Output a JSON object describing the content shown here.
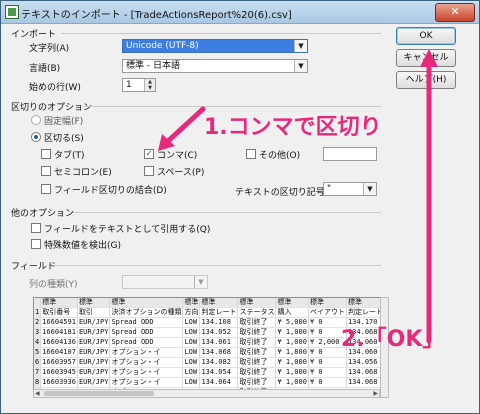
{
  "window": {
    "title": "テキストのインポート - [TradeActionsReport%20(6).csv]",
    "close": "✕"
  },
  "import": {
    "section": "インポート",
    "charset_label": "文字列(A)",
    "charset_value": "Unicode (UTF-8)",
    "language_label": "言語(B)",
    "language_value": "標準 - 日本語",
    "start_row_label": "始めの行(W)",
    "start_row_value": "1"
  },
  "separator": {
    "section": "区切りのオプション",
    "fixed_width": "固定幅(F)",
    "separated": "区切る(S)",
    "tab": "タブ(T)",
    "comma": "コンマ(C)",
    "other": "その他(O)",
    "semicolon": "セミコロン(E)",
    "space": "スペース(P)",
    "merge": "フィールド区切りの結合(D)",
    "text_delimiter_label": "テキストの区切り記号(X)",
    "text_delimiter_value": "\""
  },
  "other_options": {
    "section": "他のオプション",
    "quoted_as_text": "フィールドをテキストとして引用する(Q)",
    "detect_special": "特殊数値を検出(G)"
  },
  "fields": {
    "section": "フィールド",
    "column_type_label": "列の種類(Y)",
    "columns": [
      "",
      "標準",
      "標準",
      "標準",
      "標準",
      "標準",
      "標準",
      "標準",
      "標準",
      "標準",
      "標準",
      "標準"
    ],
    "rows": [
      [
        "1",
        "取引番号",
        "取引",
        "決済オプションの種類",
        "方向",
        "判定レート",
        "ステータス",
        "購入",
        "ペイアウト",
        "判定レート",
        "判定"
      ],
      [
        "2",
        "16604591",
        "EUR/JPY",
        "Spread ODD",
        "LOW",
        "134.108",
        "取引終了",
        "¥ 5,000",
        "¥ 0",
        "134.170",
        "\"05"
      ],
      [
        "3",
        "16604181",
        "EUR/JPY",
        "Spread ODD",
        "LOW",
        "134.052",
        "取引終了",
        "¥ 1,000",
        "¥ 0",
        "134.068",
        "\"05"
      ],
      [
        "4",
        "16604136",
        "EUR/JPY",
        "Spread ODD",
        "LOW",
        "134.061",
        "取引終了",
        "¥ 1,000",
        "¥ 2,000",
        "134.060",
        "\"05"
      ],
      [
        "5",
        "16604107",
        "EUR/JPY",
        "オプション・イ",
        "LOW",
        "134.068",
        "取引終了",
        "¥ 1,800",
        "¥ 0",
        "134.060",
        "\"05"
      ],
      [
        "6",
        "16603957",
        "EUR/JPY",
        "オプション・イ",
        "LOW",
        "134.082",
        "取引終了",
        "¥ 1,000",
        "¥ 0",
        "134.056",
        "\"05"
      ],
      [
        "7",
        "16603945",
        "EUR/JPY",
        "オプション・イ",
        "LOW",
        "134.054",
        "取引終了",
        "¥ 1,000",
        "¥ 0",
        "134.068",
        "\"05"
      ],
      [
        "8",
        "16603936",
        "EUR/JPY",
        "オプション・イ",
        "LOW",
        "134.064",
        "取引終了",
        "¥ 1,000",
        "¥ 0",
        "134.068",
        "\"05"
      ],
      [
        "9",
        "16603774",
        "EUR/JPY",
        "オプション・イ",
        "LOW",
        "134.012",
        "取引終了",
        "¥ 1,000",
        "¥ 0",
        "134.057",
        "\"05"
      ]
    ]
  },
  "buttons": {
    "ok": "OK",
    "cancel": "キャンセル",
    "help": "ヘルプ(H)"
  },
  "annotations": {
    "step1": "1.コンマで区切り",
    "step2": "2.「OK」"
  },
  "colors": {
    "annotation": "#e6297a",
    "selected": "#3d7fe0"
  }
}
